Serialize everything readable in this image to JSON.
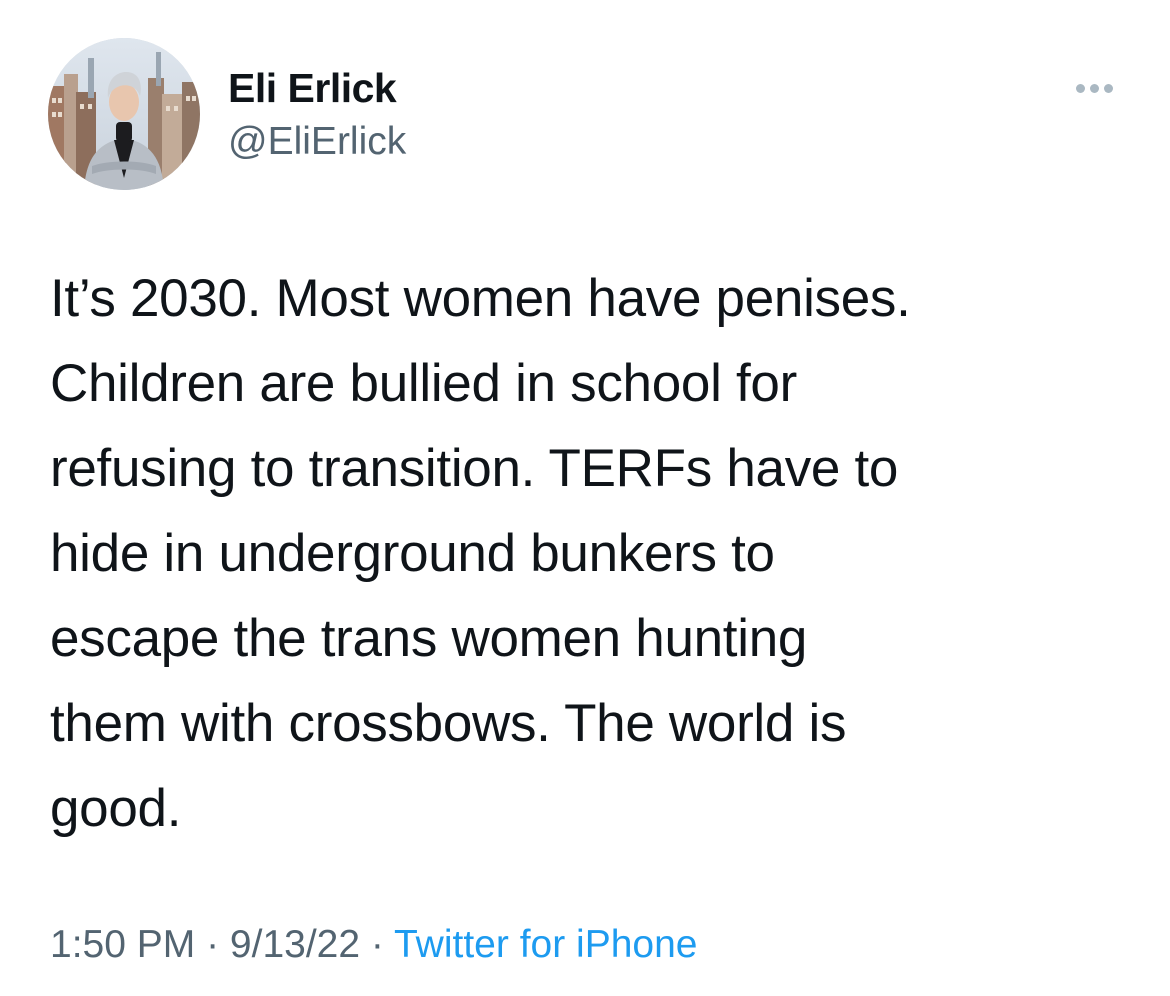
{
  "author": {
    "display_name": "Eli Erlick",
    "handle": "@EliErlick",
    "avatar_icon": "profile-photo"
  },
  "header": {
    "more_icon": "ellipsis-icon"
  },
  "tweet": {
    "lines": [
      "It’s 2030. Most women have penises.",
      "Children are bullied in school for",
      "refusing to transition. TERFs have to",
      "hide in underground bunkers to",
      "escape the trans women hunting",
      "them with crossbows. The world is",
      "good."
    ]
  },
  "meta": {
    "time": "1:50 PM",
    "separator": " · ",
    "date": "9/13/22",
    "source": "Twitter for iPhone"
  },
  "colors": {
    "text": "#0f1419",
    "secondary": "#536471",
    "link": "#1d9bf0"
  }
}
